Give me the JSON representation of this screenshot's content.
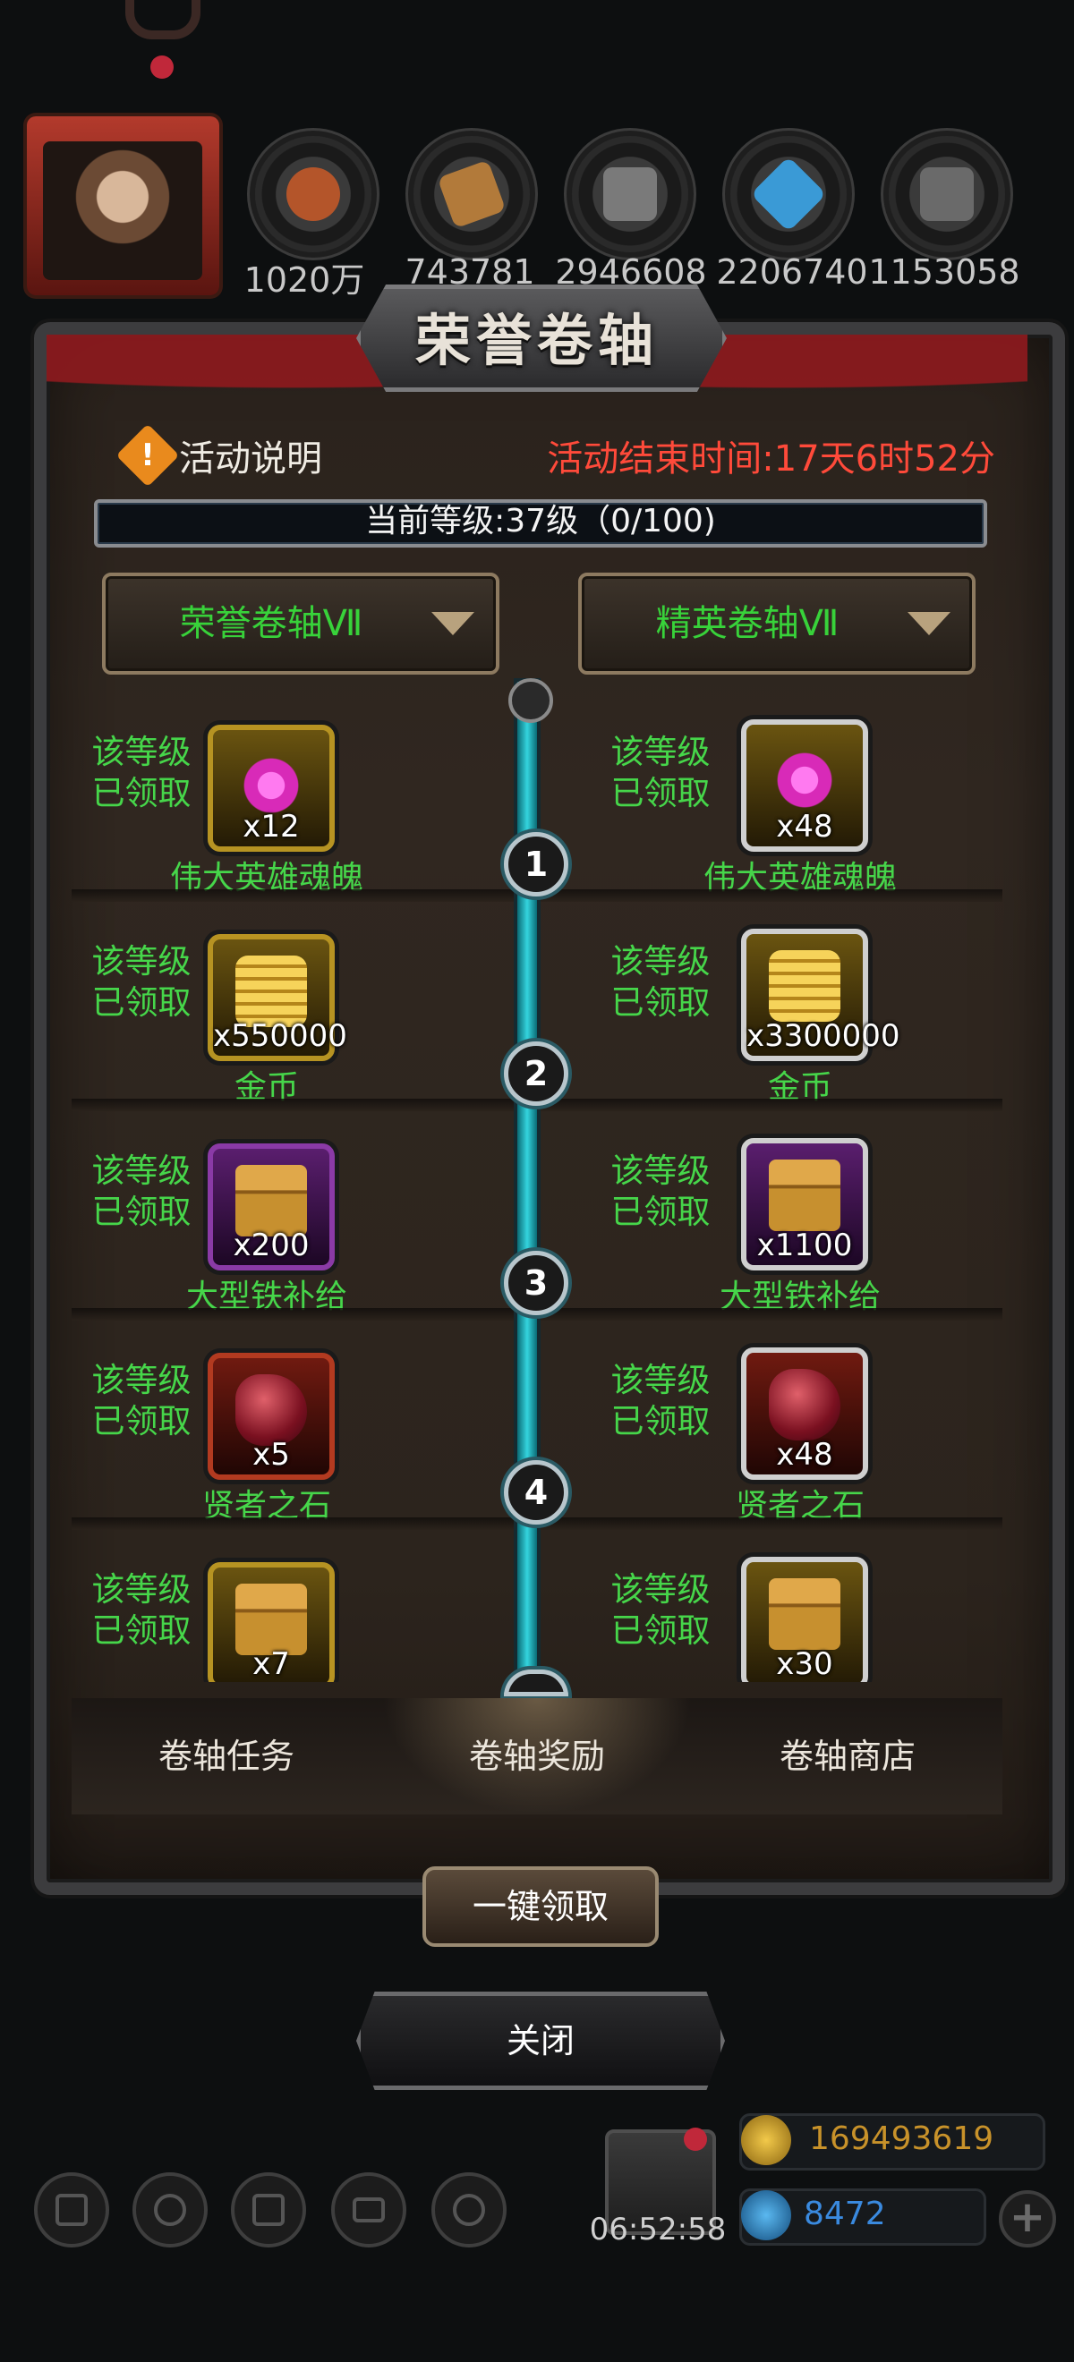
{
  "header": {
    "title": "荣誉卷轴",
    "resources": [
      {
        "name": "meat-icon",
        "value": "1020万",
        "color": "#b4552a"
      },
      {
        "name": "wood-icon",
        "value": "743781",
        "color": "#b27a3a"
      },
      {
        "name": "iron-icon",
        "value": "2946608",
        "color": "#7a7a7a"
      },
      {
        "name": "crystal-icon",
        "value": "2206740",
        "color": "#3a9ad6"
      },
      {
        "name": "steel-icon",
        "value": "1153058",
        "color": "#6a6a6a"
      }
    ]
  },
  "info": {
    "label": "活动说明",
    "icon": "!",
    "end_time": "活动结束时间:17天6时52分"
  },
  "level": {
    "text": "当前等级:37级（0/100)",
    "current": 37,
    "progress": 0,
    "max": 100
  },
  "dropdowns": {
    "left": "荣誉卷轴Ⅶ",
    "right": "精英卷轴Ⅶ"
  },
  "rows": [
    {
      "level": "1",
      "left": {
        "status": "该等级\n已领取",
        "count": "x12",
        "name": "伟大英雄魂魄",
        "icon": "soul-icon"
      },
      "right": {
        "status": "该等级\n已领取",
        "count": "x48",
        "name": "伟大英雄魂魄",
        "icon": "soul-icon"
      }
    },
    {
      "level": "2",
      "left": {
        "status": "该等级\n已领取",
        "count": "x550000",
        "name": "金币",
        "icon": "gold-coin-icon"
      },
      "right": {
        "status": "该等级\n已领取",
        "count": "x3300000",
        "name": "金币",
        "icon": "gold-coin-icon"
      }
    },
    {
      "level": "3",
      "left": {
        "status": "该等级\n已领取",
        "count": "x200",
        "name": "大型铁补给",
        "icon": "iron-supply-chest-icon"
      },
      "right": {
        "status": "该等级\n已领取",
        "count": "x1100",
        "name": "大型铁补给",
        "icon": "iron-supply-chest-icon"
      }
    },
    {
      "level": "4",
      "left": {
        "status": "该等级\n已领取",
        "count": "x5",
        "name": "贤者之石",
        "icon": "sage-stone-icon"
      },
      "right": {
        "status": "该等级\n已领取",
        "count": "x48",
        "name": "贤者之石",
        "icon": "sage-stone-icon"
      }
    },
    {
      "level": "",
      "left": {
        "status": "该等级\n已领取",
        "count": "x7",
        "name": "",
        "icon": "chest-icon"
      },
      "right": {
        "status": "该等级\n已领取",
        "count": "x30",
        "name": "",
        "icon": "chest-icon"
      }
    }
  ],
  "tabs": [
    "卷轴任务",
    "卷轴奖励",
    "卷轴商店"
  ],
  "buttons": {
    "claim_all": "一键领取",
    "close": "关闭"
  },
  "bottom": {
    "gift_timer": "06:52:58",
    "gold": "169493619",
    "gems": "8472",
    "plus": "+"
  }
}
